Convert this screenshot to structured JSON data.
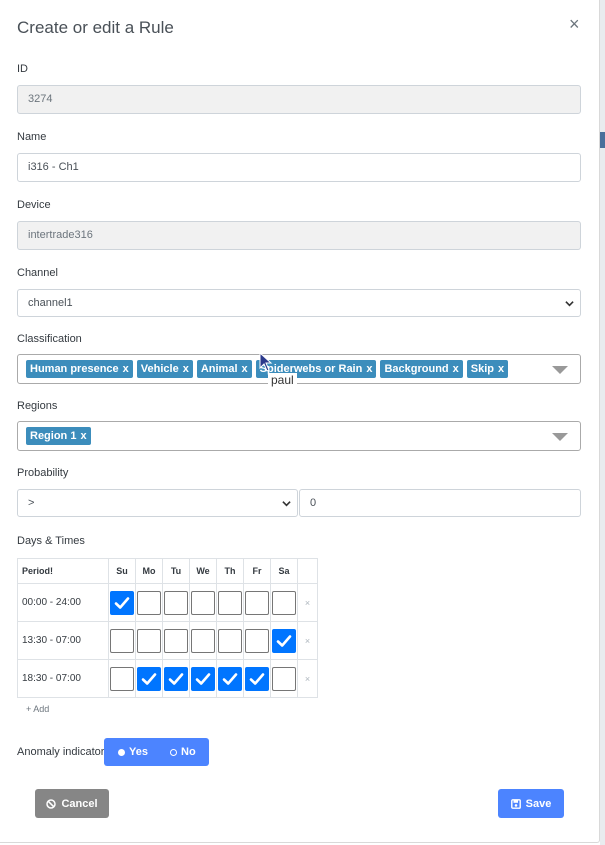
{
  "modal": {
    "title": "Create or edit a Rule",
    "close": "×"
  },
  "fields": {
    "id": {
      "label": "ID",
      "value": "3274"
    },
    "name": {
      "label": "Name",
      "value": "i316 - Ch1"
    },
    "device": {
      "label": "Device",
      "value": "intertrade316"
    },
    "channel": {
      "label": "Channel",
      "value": "channel1"
    },
    "classification": {
      "label": "Classification",
      "tags": [
        "Human presence",
        "Vehicle",
        "Animal",
        "Spiderwebs or Rain",
        "Background",
        "Skip"
      ],
      "remove": "x"
    },
    "regions": {
      "label": "Regions",
      "tags": [
        "Region 1"
      ],
      "remove": "x"
    },
    "probability": {
      "label": "Probability",
      "operator": ">",
      "value": "0"
    }
  },
  "tooltip": "paul",
  "schedule": {
    "label": "Days & Times",
    "period_header": "Period!",
    "days": [
      "Su",
      "Mo",
      "Tu",
      "We",
      "Th",
      "Fr",
      "Sa"
    ],
    "rows": [
      {
        "time": "00:00 - 24:00",
        "checked": [
          true,
          false,
          false,
          false,
          false,
          false,
          false
        ]
      },
      {
        "time": "13:30 - 07:00",
        "checked": [
          false,
          false,
          false,
          false,
          false,
          false,
          true
        ]
      },
      {
        "time": "18:30 - 07:00",
        "checked": [
          false,
          true,
          true,
          true,
          true,
          true,
          false
        ]
      }
    ],
    "remove": "×",
    "add": "+ Add"
  },
  "anomaly": {
    "label": "Anomaly indicator",
    "yes": "Yes",
    "no": "No",
    "selected": "Yes"
  },
  "buttons": {
    "cancel": "Cancel",
    "save": "Save"
  },
  "colors": {
    "primary": "#4c84ff",
    "tag": "#3c8dbc",
    "checkbox": "#0075ff",
    "cancel": "#868686"
  }
}
